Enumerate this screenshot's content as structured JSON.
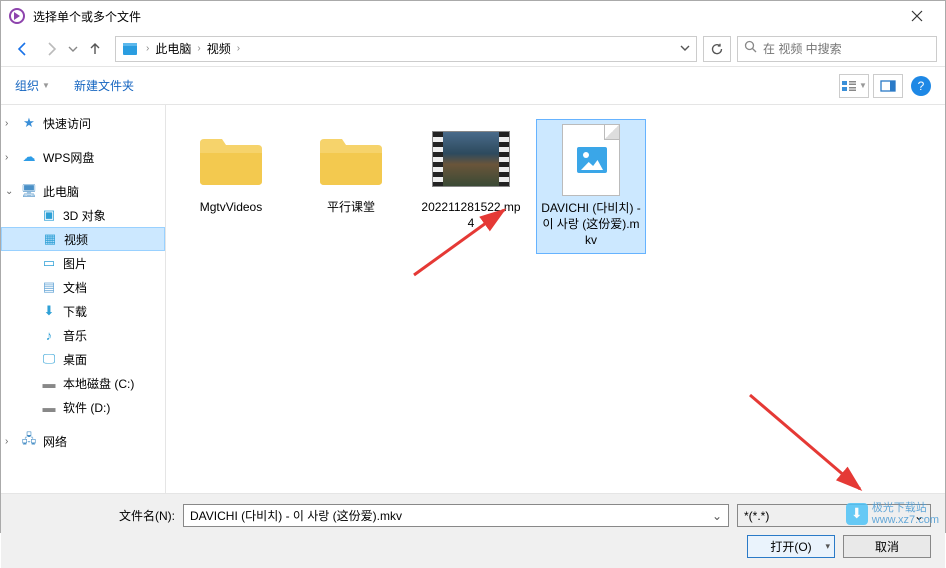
{
  "window": {
    "title": "选择单个或多个文件"
  },
  "breadcrumb": {
    "this_pc": "此电脑",
    "videos": "视频"
  },
  "search": {
    "placeholder": "在 视频 中搜索"
  },
  "toolbar": {
    "organize": "组织",
    "new_folder": "新建文件夹"
  },
  "sidebar": {
    "quick_access": "快速访问",
    "wps": "WPS网盘",
    "this_pc": "此电脑",
    "objects3d": "3D 对象",
    "videos": "视频",
    "pictures": "图片",
    "documents": "文档",
    "downloads": "下载",
    "music": "音乐",
    "desktop": "桌面",
    "local_c": "本地磁盘 (C:)",
    "soft_d": "软件 (D:)",
    "network": "网络"
  },
  "files": {
    "f1": "MgtvVideos",
    "f2": "平行课堂",
    "f3": "202211281522.mp4",
    "f4": "DAVICHI (다비치) - 이 사랑 (这份爱).mkv"
  },
  "bottom": {
    "filename_label": "文件名(N):",
    "filename_value": "DAVICHI (다비치) - 이 사랑 (这份爱).mkv",
    "filter": "*(*.*)",
    "open": "打开(O)",
    "cancel": "取消"
  },
  "watermark": {
    "name": "极光下载站",
    "url": "www.xz7.com"
  }
}
